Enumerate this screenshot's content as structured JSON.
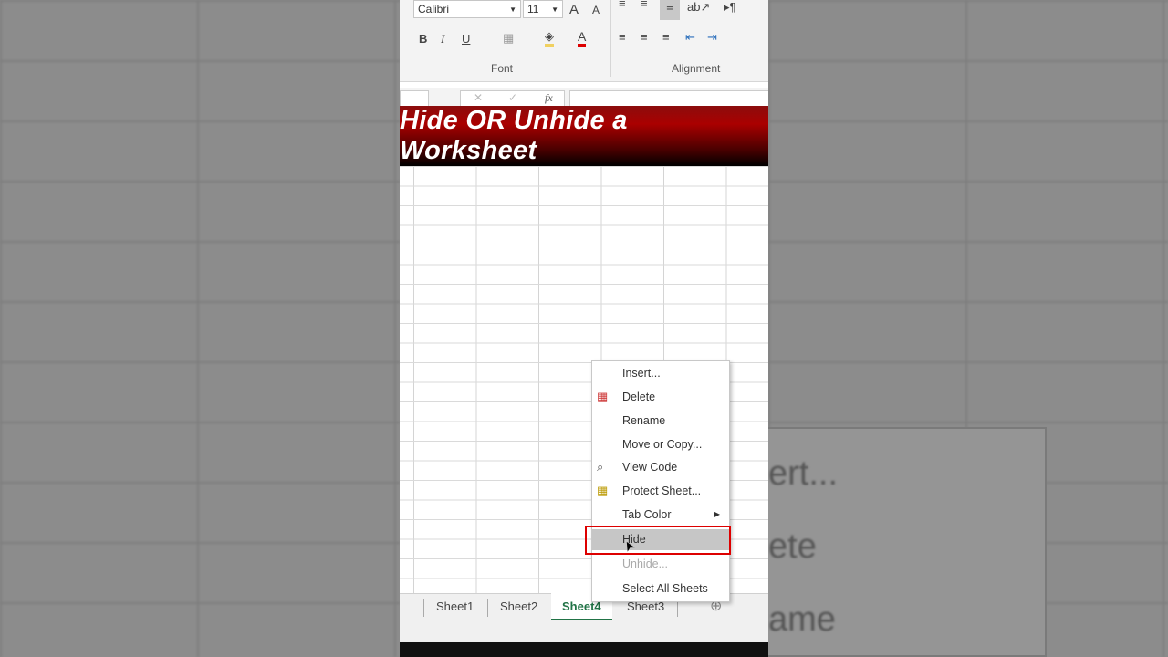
{
  "ribbon": {
    "font_name": "Calibri",
    "font_size": "11",
    "bold": "B",
    "italic": "I",
    "underline": "U",
    "font_group": "Font",
    "alignment_group": "Alignment"
  },
  "formula_bar": {
    "fx": "fx",
    "cancel": "✕",
    "enter": "✓"
  },
  "title": "Hide OR Unhide a Worksheet",
  "sheet_tabs": [
    "Sheet1",
    "Sheet2",
    "Sheet4",
    "Sheet3"
  ],
  "active_tab": "Sheet4",
  "context_menu": [
    {
      "label": "Insert...",
      "icon": ""
    },
    {
      "label": "Delete",
      "icon": "delete-sheet-icon"
    },
    {
      "label": "Rename",
      "icon": ""
    },
    {
      "label": "Move or Copy...",
      "icon": ""
    },
    {
      "label": "View Code",
      "icon": "view-code-icon"
    },
    {
      "label": "Protect Sheet...",
      "icon": "protect-sheet-icon"
    },
    {
      "label": "Tab Color",
      "icon": ""
    },
    {
      "label": "Hide",
      "icon": "",
      "state": "highlighted"
    },
    {
      "label": "Unhide...",
      "icon": "",
      "state": "disabled"
    },
    {
      "label": "Select All Sheets",
      "icon": ""
    }
  ],
  "background_menu": [
    "ert...",
    "ete",
    "ame"
  ],
  "colors": {
    "title_red": "#a00000",
    "excel_green": "#217346",
    "highlight_border": "#dd0000"
  }
}
